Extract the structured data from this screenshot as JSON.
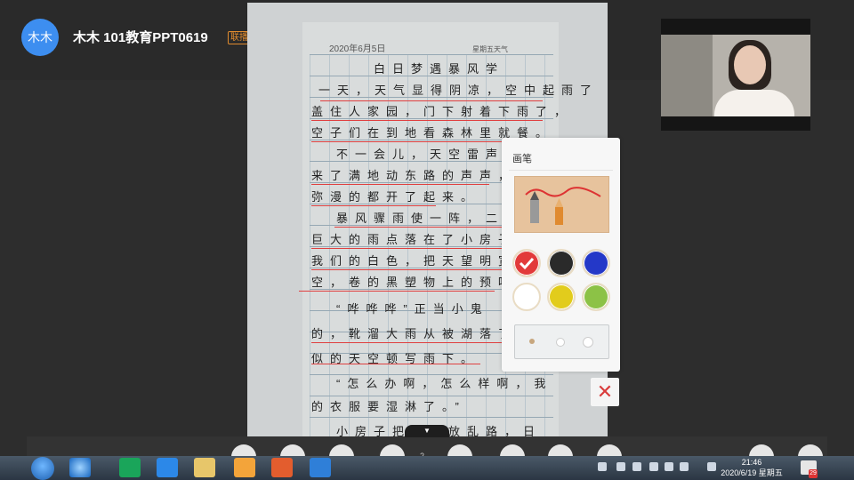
{
  "header": {
    "avatar_text": "木木",
    "room_title": "木木 101教育PPT0619",
    "badge": "联播"
  },
  "document": {
    "date": "2020年6月5日",
    "weekday": "星期五天气",
    "title_line": "白日梦遇暴风学",
    "handwriting_lines": [
      "一天，天气显得阴凉，空中起雨了",
      "盖住人家园，门下射着下雨了，",
      "空子们在到地看森林里就餐。",
      "不一会儿，天空雷声滚滚，",
      "来了满地动东路的声声，冷风",
      "弥漫的都开了起来。",
      "暴风骤雨使一阵，二阵，",
      "巨大的雨点落在了小房子上，",
      "我们的白色，把天望明宽吧",
      "空，卷的黑塑物上的预吹。",
      "“哗哗哗”正当小鬼",
      "的，靴溜大雨从被湖落了一",
      "似的天空顿写雨下。",
      "“怎么办啊，怎么样啊，我",
      "的衣服要湿淋了。”",
      "小房子把身大放乱路，日"
    ]
  },
  "pen_panel": {
    "title": "画笔",
    "colors": [
      "#e23a3a",
      "#2a2a2a",
      "#2438c8",
      "#ffffff",
      "#e2cc1c",
      "#8cc246"
    ],
    "selected_color": "#e23a3a",
    "selected_size": "small"
  },
  "close_icon_label": "✕",
  "toolbar": {
    "handle_label": "▼",
    "page_indicator": "2"
  },
  "taskbar": {
    "time": "21:46",
    "date": "2020/6/19 星期五",
    "notification_count": "29"
  }
}
